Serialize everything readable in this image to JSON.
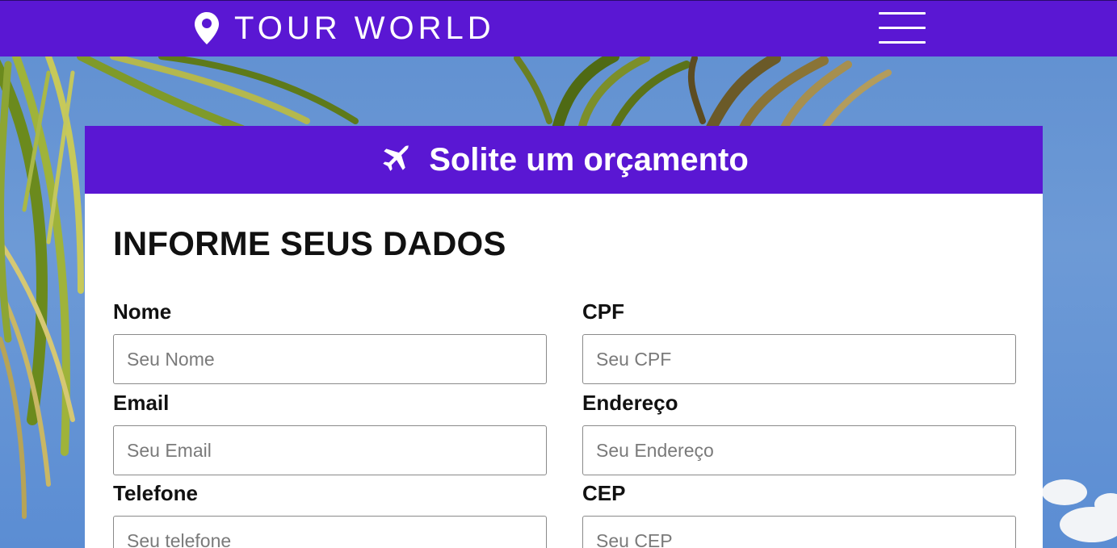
{
  "nav": {
    "brand": "TOUR WORLD",
    "brand_icon": "map-pin-icon",
    "menu_icon": "hamburger-menu-icon"
  },
  "quote": {
    "title": "Solite um orçamento",
    "title_icon": "plane-icon",
    "form_heading": "INFORME SEUS DADOS",
    "fields": {
      "nome": {
        "label": "Nome",
        "placeholder": "Seu Nome"
      },
      "cpf": {
        "label": "CPF",
        "placeholder": "Seu CPF"
      },
      "email": {
        "label": "Email",
        "placeholder": "Seu Email"
      },
      "endereco": {
        "label": "Endereço",
        "placeholder": "Seu Endereço"
      },
      "telefone": {
        "label": "Telefone",
        "placeholder": "Seu telefone"
      },
      "cep": {
        "label": "CEP",
        "placeholder": "Seu CEP"
      }
    }
  },
  "colors": {
    "brand_purple": "#5a17d3",
    "sky_blue": "#6d9ad6"
  }
}
